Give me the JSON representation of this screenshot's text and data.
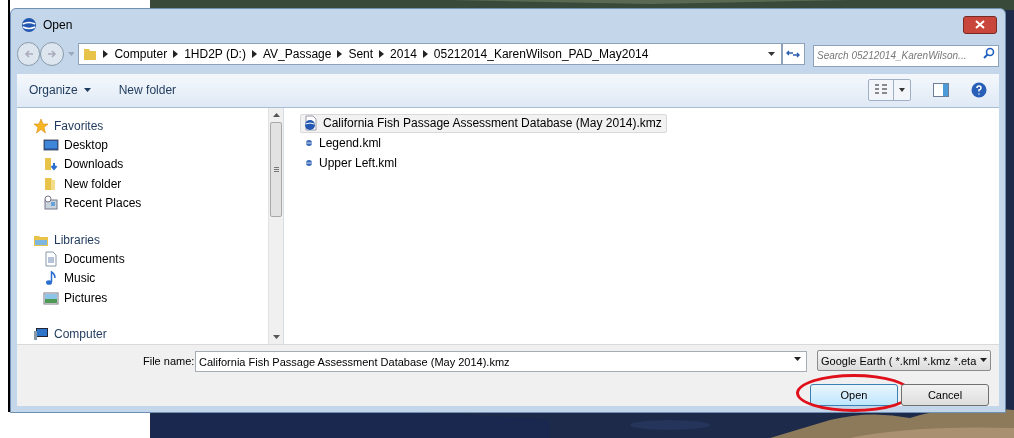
{
  "window": {
    "title": "Open"
  },
  "address": {
    "breadcrumbs": [
      "Computer",
      "1HD2P (D:)",
      "AV_Passage",
      "Sent",
      "2014",
      "05212014_KarenWilson_PAD_May2014"
    ]
  },
  "search": {
    "placeholder": "Search 05212014_KarenWilson..."
  },
  "toolbar": {
    "buttons": [
      {
        "label": "Organize",
        "dropdown": true
      },
      {
        "label": "New folder",
        "dropdown": false
      }
    ]
  },
  "sidebar": {
    "groups": [
      {
        "label": "Favorites",
        "kind": "star",
        "children": [
          {
            "label": "Desktop",
            "kind": "desktop"
          },
          {
            "label": "Downloads",
            "kind": "downloads"
          },
          {
            "label": "New folder",
            "kind": "folder"
          },
          {
            "label": "Recent Places",
            "kind": "recent"
          }
        ]
      },
      {
        "label": "Libraries",
        "kind": "library",
        "children": [
          {
            "label": "Documents",
            "kind": "document"
          },
          {
            "label": "Music",
            "kind": "music"
          },
          {
            "label": "Pictures",
            "kind": "pictures"
          }
        ]
      },
      {
        "label": "Computer",
        "kind": "computer"
      }
    ]
  },
  "files": [
    {
      "name": "California Fish Passage Assessment Database (May 2014).kmz",
      "kind": "kmz",
      "selected": true
    },
    {
      "name": "Legend.kml",
      "kind": "kml",
      "selected": false
    },
    {
      "name": "Upper Left.kml",
      "kind": "kml",
      "selected": false
    }
  ],
  "file_name": {
    "label": "File name:",
    "value": "California Fish Passage Assessment Database (May 2014).kmz"
  },
  "file_type": {
    "value": "Google Earth ( *.kml *.kmz *.eta"
  },
  "buttons": [
    {
      "label": "Open",
      "highlighted": true
    },
    {
      "label": "Cancel",
      "highlighted": false
    }
  ]
}
